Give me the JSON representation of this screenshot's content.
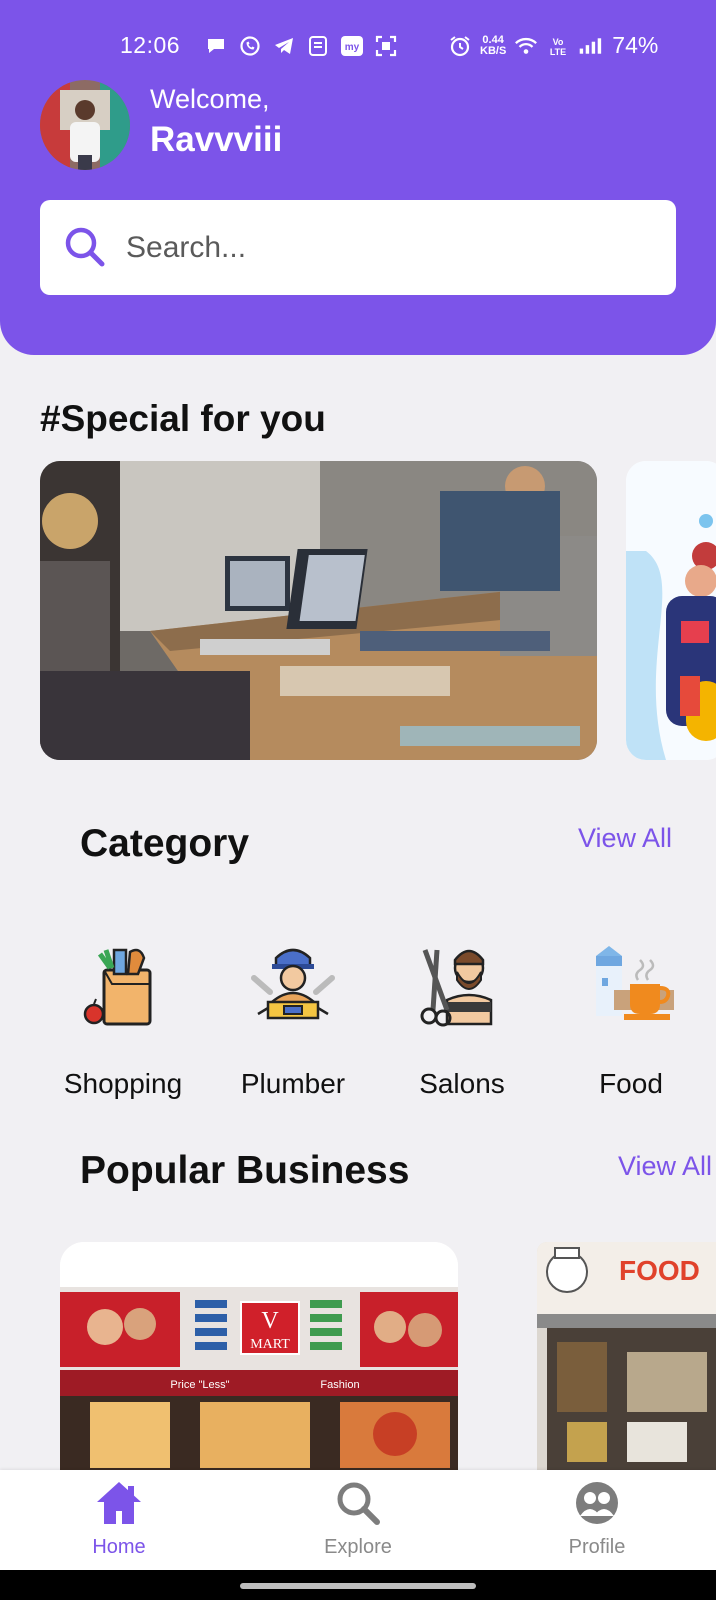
{
  "status_bar": {
    "time": "12:06",
    "net_speed_value": "0.44",
    "net_speed_unit": "KB/S",
    "battery": "74%"
  },
  "user": {
    "welcome": "Welcome,",
    "name": "Ravvviii"
  },
  "search": {
    "placeholder": "Search..."
  },
  "special": {
    "title": "#Special for you"
  },
  "category": {
    "title": "Category",
    "view_all": "View All",
    "items": [
      {
        "label": "Shopping",
        "icon": "grocery-bag-icon"
      },
      {
        "label": "Plumber",
        "icon": "plumber-icon"
      },
      {
        "label": "Salons",
        "icon": "barber-icon"
      },
      {
        "label": "Food",
        "icon": "food-cup-icon"
      }
    ]
  },
  "popular": {
    "title": "Popular Business",
    "view_all": "View All",
    "vmart": {
      "sign_v": "V",
      "sign_mart": "MART",
      "strip_left": "Price \"Less\"",
      "strip_right": "Fashion"
    },
    "food": {
      "sign": "FOOD"
    }
  },
  "bottom_nav": {
    "home": "Home",
    "explore": "Explore",
    "profile": "Profile"
  },
  "colors": {
    "accent": "#7c54e9",
    "background": "#f1f0f3"
  }
}
